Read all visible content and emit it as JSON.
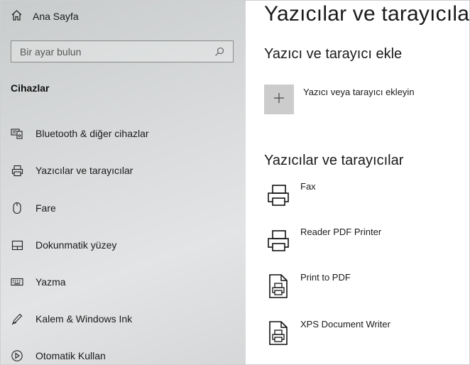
{
  "sidebar": {
    "home_label": "Ana Sayfa",
    "search_placeholder": "Bir ayar bulun",
    "section_title": "Cihazlar",
    "items": [
      {
        "label": "Bluetooth & diğer cihazlar",
        "icon": "bluetooth-devices-icon"
      },
      {
        "label": "Yazıcılar ve tarayıcılar",
        "icon": "printer-icon"
      },
      {
        "label": "Fare",
        "icon": "mouse-icon"
      },
      {
        "label": "Dokunmatik yüzey",
        "icon": "touchpad-icon"
      },
      {
        "label": "Yazma",
        "icon": "keyboard-icon"
      },
      {
        "label": "Kalem & Windows Ink",
        "icon": "pen-icon"
      },
      {
        "label": "Otomatik Kullan",
        "icon": "autoplay-icon"
      }
    ]
  },
  "main": {
    "title": "Yazıcılar ve tarayıcılar",
    "add_section_title": "Yazıcı ve tarayıcı ekle",
    "add_label": "Yazıcı veya tarayıcı ekleyin",
    "list_section_title": "Yazıcılar ve tarayıcılar",
    "devices": [
      {
        "label": "Fax",
        "icon": "fax-printer-icon"
      },
      {
        "label": "Reader PDF Printer",
        "icon": "printer-icon"
      },
      {
        "label": "Print to PDF",
        "icon": "pdf-printer-icon"
      },
      {
        "label": "XPS Document Writer",
        "icon": "document-printer-icon"
      }
    ]
  },
  "colors": {
    "sidebar_bg": "#d8dadb",
    "add_tile_bg": "#cccccc",
    "text": "#1a1a1a"
  }
}
